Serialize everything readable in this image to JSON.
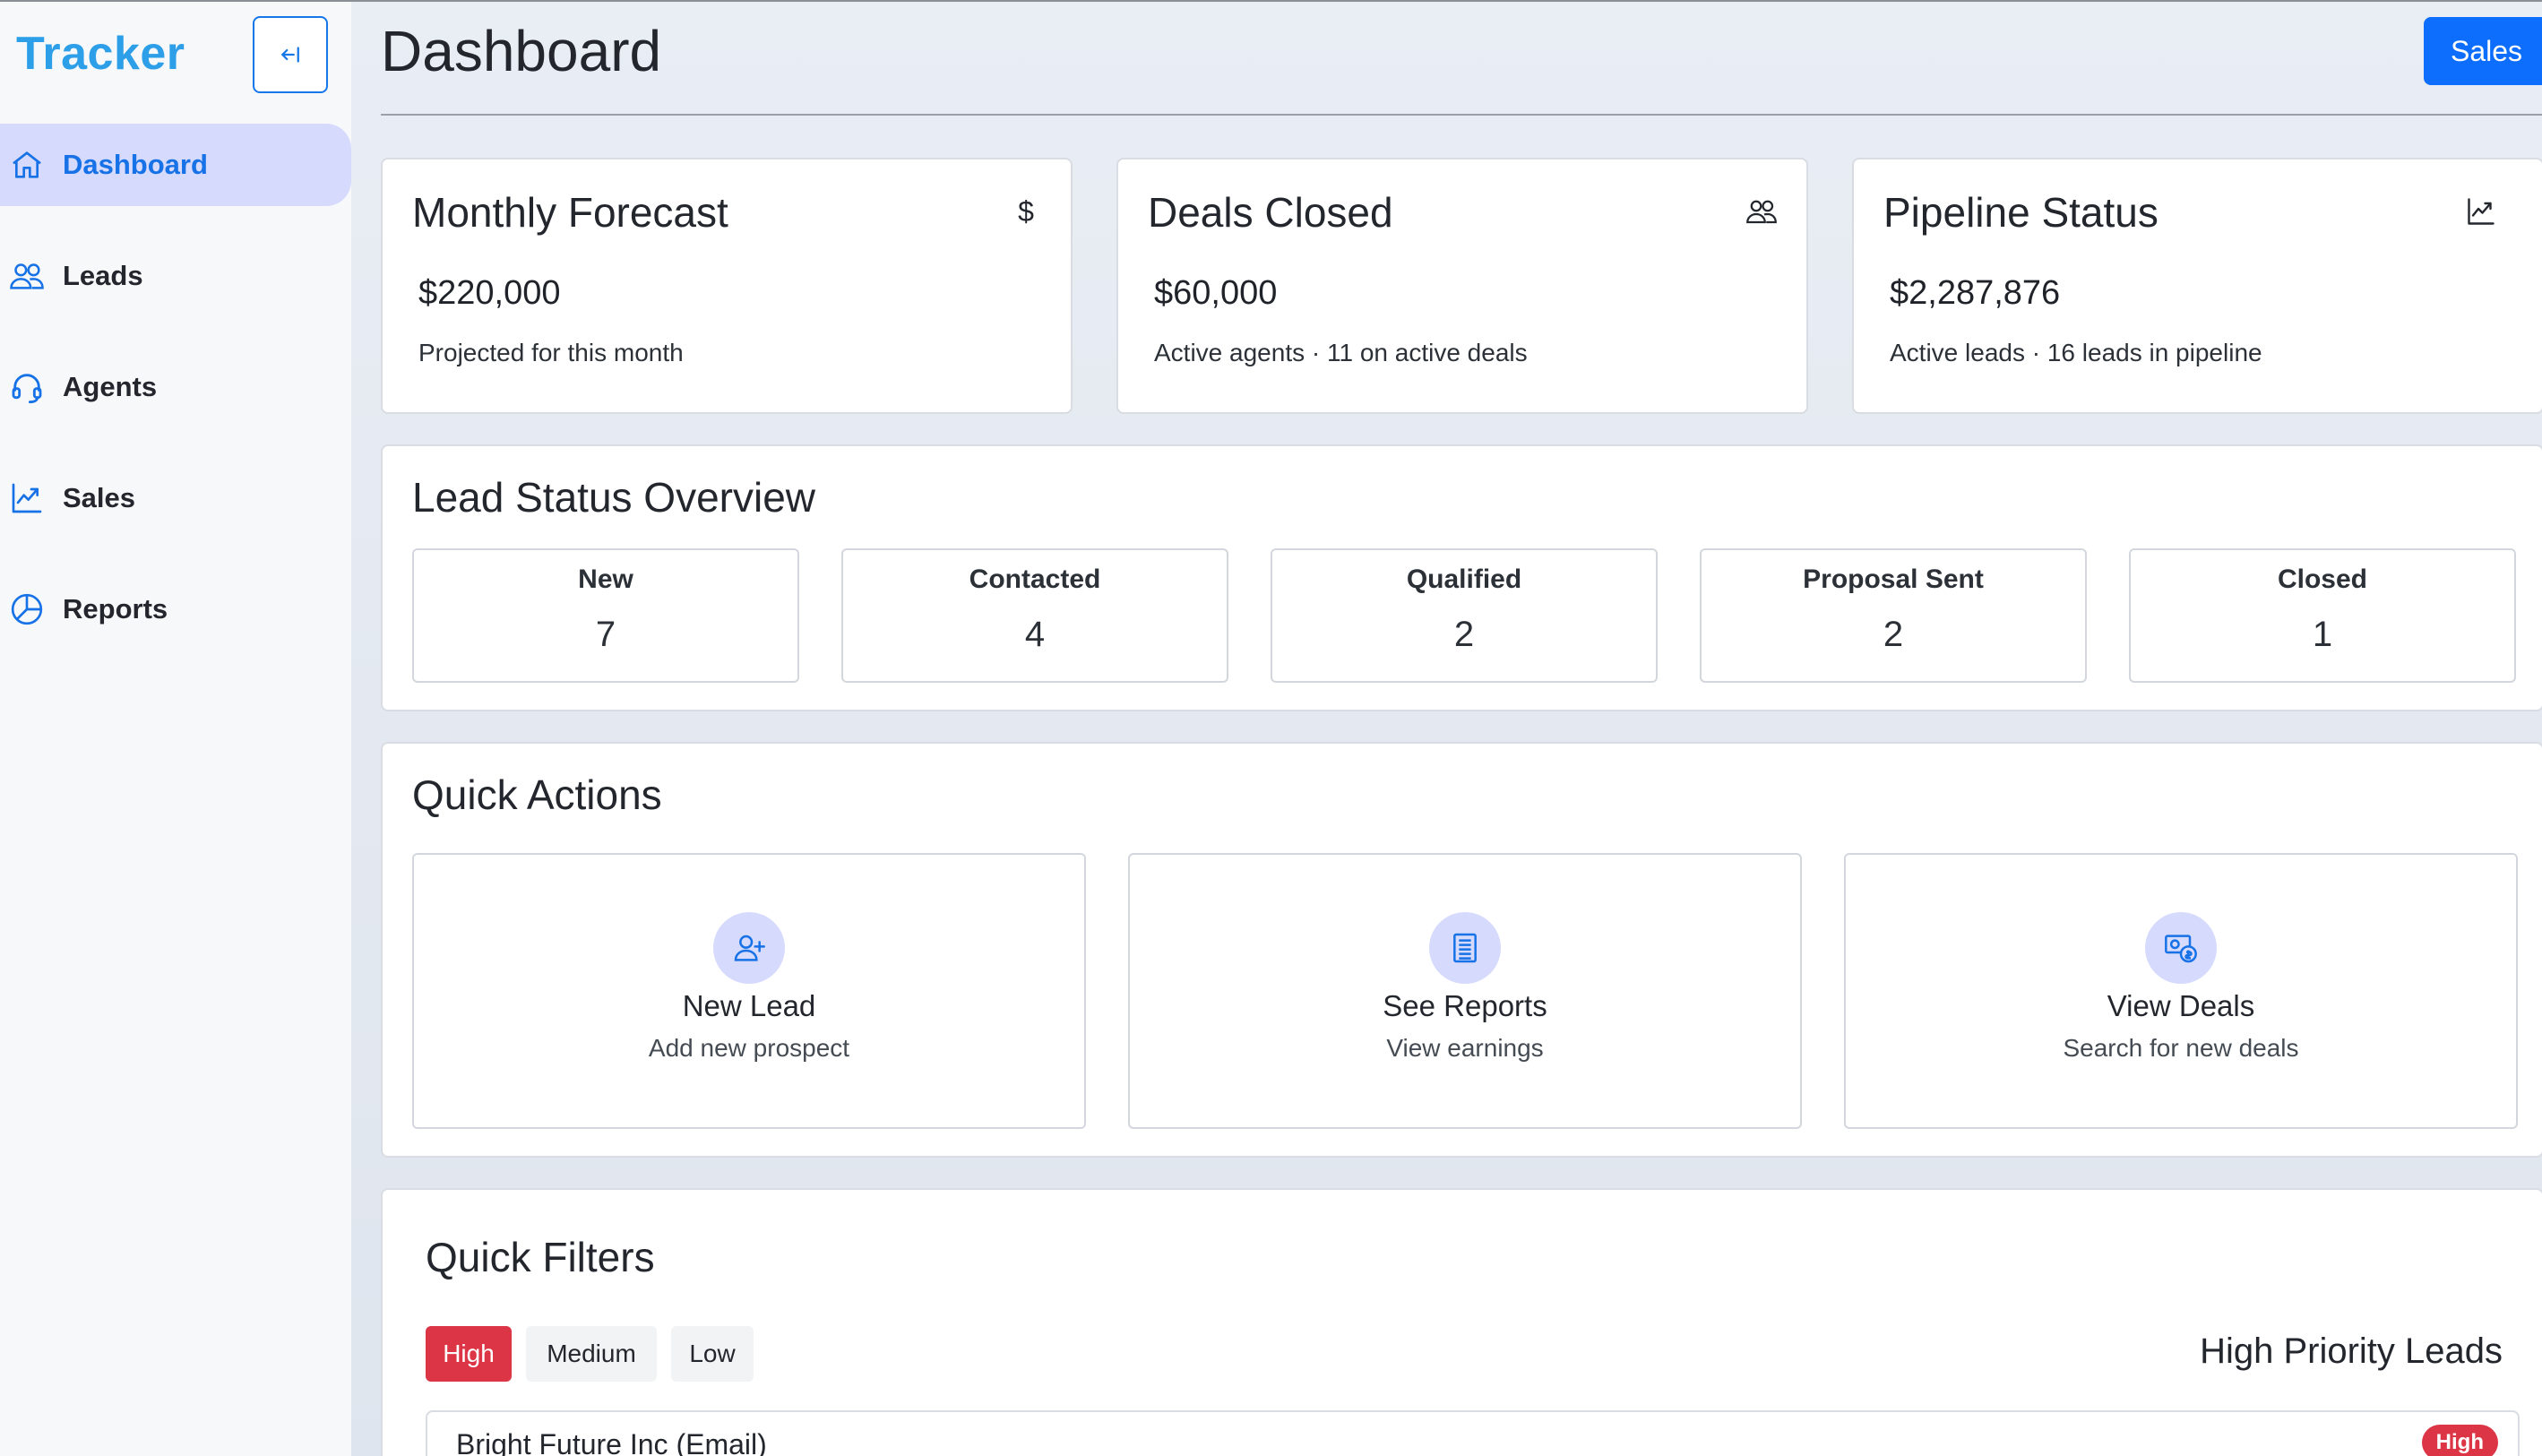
{
  "sidebar": {
    "brand": "Tracker",
    "items": [
      {
        "label": "Dashboard",
        "icon": "home-icon",
        "active": true
      },
      {
        "label": "Leads",
        "icon": "users-icon"
      },
      {
        "label": "Agents",
        "icon": "headset-icon"
      },
      {
        "label": "Sales",
        "icon": "trend-up-icon"
      },
      {
        "label": "Reports",
        "icon": "pie-chart-icon"
      }
    ]
  },
  "header": {
    "title": "Dashboard",
    "role_button": "Sales"
  },
  "stats": [
    {
      "title": "Monthly Forecast",
      "icon": "dollar-icon",
      "value": "$220,000",
      "sub": "Projected for this month"
    },
    {
      "title": "Deals Closed",
      "icon": "users-icon",
      "value": "$60,000",
      "sub": "Active agents · 11 on active deals"
    },
    {
      "title": "Pipeline Status",
      "icon": "trend-up-icon",
      "value": "$2,287,876",
      "sub": "Active leads · 16 leads in pipeline"
    }
  ],
  "lead_status": {
    "title": "Lead Status Overview",
    "items": [
      {
        "label": "New",
        "value": "7"
      },
      {
        "label": "Contacted",
        "value": "4"
      },
      {
        "label": "Qualified",
        "value": "2"
      },
      {
        "label": "Proposal Sent",
        "value": "2"
      },
      {
        "label": "Closed",
        "value": "1"
      }
    ]
  },
  "quick_actions": {
    "title": "Quick Actions",
    "items": [
      {
        "title": "New Lead",
        "sub": "Add new prospect",
        "icon": "add-user-icon"
      },
      {
        "title": "See Reports",
        "sub": "View earnings",
        "icon": "document-icon"
      },
      {
        "title": "View Deals",
        "sub": "Search for new deals",
        "icon": "money-search-icon"
      }
    ]
  },
  "quick_filters": {
    "title": "Quick Filters",
    "filters": [
      {
        "label": "High",
        "active": true
      },
      {
        "label": "Medium"
      },
      {
        "label": "Low"
      }
    ],
    "heading": "High Priority Leads",
    "leads": [
      {
        "name": "Bright Future Inc (Email)",
        "badge": "High"
      }
    ]
  },
  "colors": {
    "accent": "#0d6efd",
    "brand": "#2d9ee8",
    "active_nav_bg": "#d6dafc",
    "danger": "#dc3545"
  }
}
